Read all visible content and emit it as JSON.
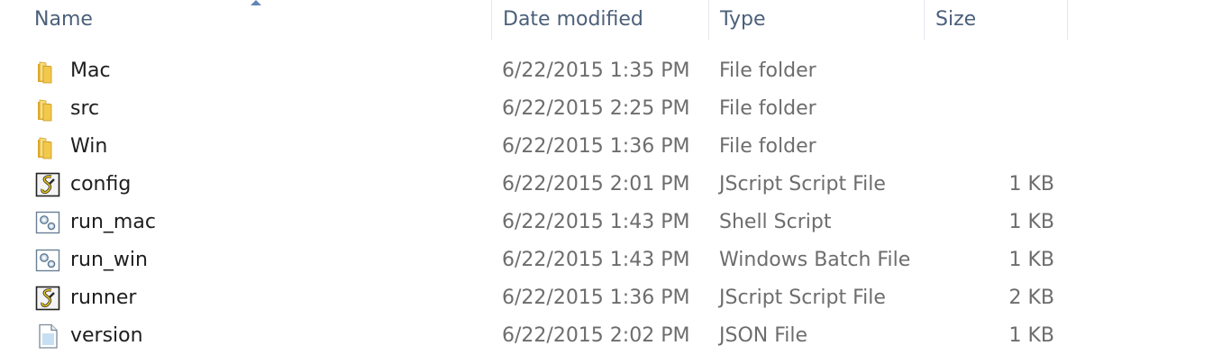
{
  "columns": {
    "name": "Name",
    "date_modified": "Date modified",
    "type": "Type",
    "size": "Size"
  },
  "files": [
    {
      "name": "Mac",
      "date": "6/22/2015 1:35 PM",
      "type": "File folder",
      "size": "",
      "icon": "folder-icon"
    },
    {
      "name": "src",
      "date": "6/22/2015 2:25 PM",
      "type": "File folder",
      "size": "",
      "icon": "folder-icon"
    },
    {
      "name": "Win",
      "date": "6/22/2015 1:36 PM",
      "type": "File folder",
      "size": "",
      "icon": "folder-icon"
    },
    {
      "name": "config",
      "date": "6/22/2015 2:01 PM",
      "type": "JScript Script File",
      "size": "1 KB",
      "icon": "jscript-file-icon"
    },
    {
      "name": "run_mac",
      "date": "6/22/2015 1:43 PM",
      "type": "Shell Script",
      "size": "1 KB",
      "icon": "script-gear-file-icon"
    },
    {
      "name": "run_win",
      "date": "6/22/2015 1:43 PM",
      "type": "Windows Batch File",
      "size": "1 KB",
      "icon": "script-gear-file-icon"
    },
    {
      "name": "runner",
      "date": "6/22/2015 1:36 PM",
      "type": "JScript Script File",
      "size": "2 KB",
      "icon": "jscript-file-icon"
    },
    {
      "name": "version",
      "date": "6/22/2015 2:02 PM",
      "type": "JSON File",
      "size": "1 KB",
      "icon": "generic-file-icon"
    }
  ],
  "colors": {
    "header_text": "#4c607a",
    "name_text": "#1e1e1e",
    "detail_text": "#6d6d6d",
    "folder_yellow": "#f2c94c"
  }
}
